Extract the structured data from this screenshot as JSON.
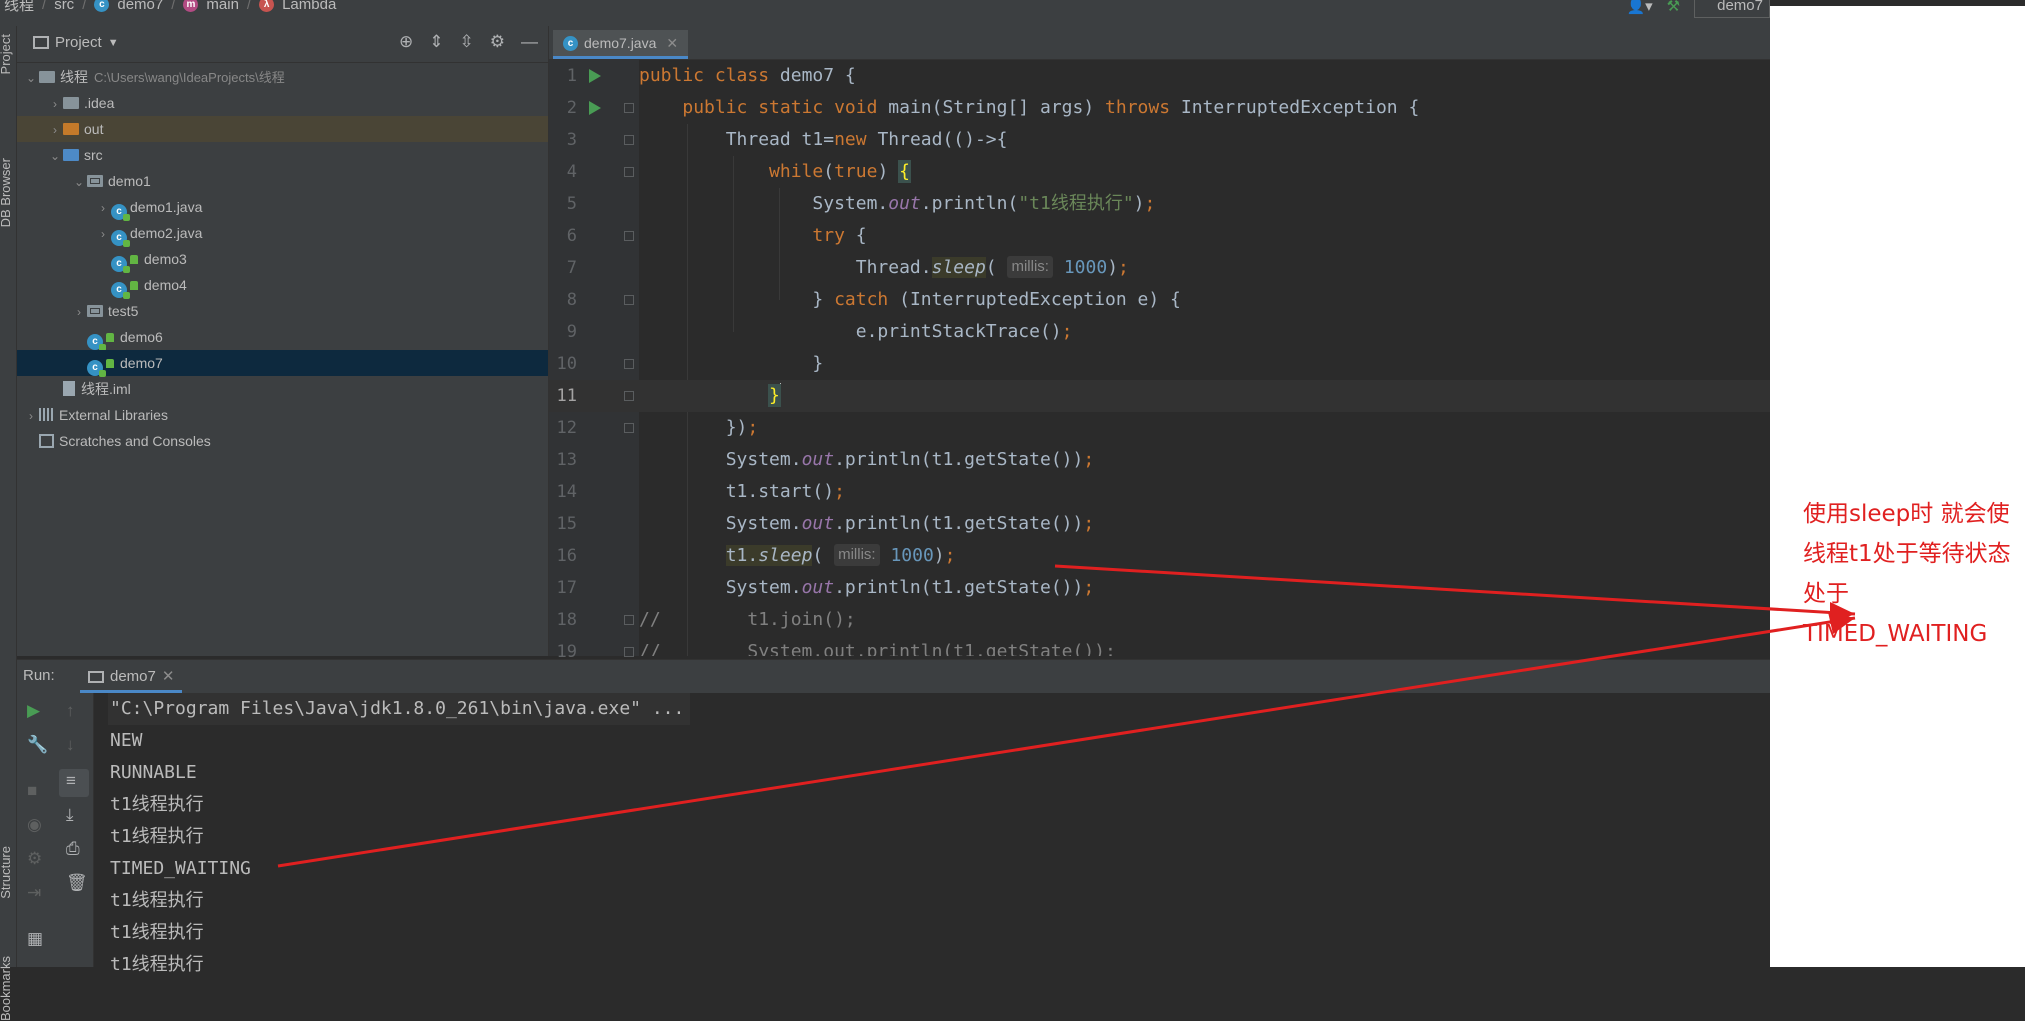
{
  "breadcrumb": {
    "items": [
      "线程",
      "src",
      "demo7",
      "main",
      "Lambda"
    ],
    "run_config": "demo7"
  },
  "left_strip": {
    "tabs": [
      "Project",
      "DB Browser",
      "Structure",
      "Bookmarks"
    ]
  },
  "project_panel": {
    "title": "Project",
    "tree": [
      {
        "label": "线程",
        "path": "C:\\Users\\wang\\IdeaProjects\\线程",
        "kind": "module",
        "depth": 0,
        "expanded": true
      },
      {
        "label": ".idea",
        "kind": "folder",
        "depth": 1,
        "expanded": false
      },
      {
        "label": "out",
        "kind": "folder-out",
        "depth": 1,
        "expanded": false
      },
      {
        "label": "src",
        "kind": "folder-src",
        "depth": 1,
        "expanded": true
      },
      {
        "label": "demo1",
        "kind": "package",
        "depth": 2,
        "expanded": true
      },
      {
        "label": "demo1.java",
        "kind": "class",
        "depth": 3,
        "expanded": false
      },
      {
        "label": "demo2.java",
        "kind": "class",
        "depth": 3,
        "expanded": false
      },
      {
        "label": "demo3",
        "kind": "class-lock",
        "depth": 3
      },
      {
        "label": "demo4",
        "kind": "class-lock",
        "depth": 3
      },
      {
        "label": "test5",
        "kind": "package",
        "depth": 2,
        "expanded": false
      },
      {
        "label": "demo6",
        "kind": "class-lock",
        "depth": 2
      },
      {
        "label": "demo7",
        "kind": "class-lock",
        "depth": 2,
        "selected": true
      },
      {
        "label": "线程.iml",
        "kind": "iml",
        "depth": 1
      },
      {
        "label": "External Libraries",
        "kind": "libs",
        "depth": 0,
        "expanded": false
      },
      {
        "label": "Scratches and Consoles",
        "kind": "scratch",
        "depth": 0
      }
    ]
  },
  "editor": {
    "tab": "demo7.java",
    "current_line": 11,
    "line_numbers": [
      "1",
      "2",
      "3",
      "4",
      "5",
      "6",
      "7",
      "8",
      "9",
      "10",
      "11",
      "12",
      "13",
      "14",
      "15",
      "16",
      "17",
      "18",
      "19"
    ],
    "hints": {
      "millis": "millis:"
    }
  },
  "run_panel": {
    "label": "Run:",
    "tab": "demo7",
    "output": [
      "\"C:\\Program Files\\Java\\jdk1.8.0_261\\bin\\java.exe\" ...",
      "NEW",
      "RUNNABLE",
      "t1线程执行",
      "t1线程执行",
      "TIMED_WAITING",
      "t1线程执行",
      "t1线程执行",
      "t1线程执行"
    ]
  },
  "annotation": {
    "lines": [
      "使用sleep时 就会使",
      "线程t1处于等待状态",
      "处于",
      "TIMED_WAITING"
    ],
    "color": "#e02020"
  },
  "colors": {
    "keyword": "#cc7832",
    "string": "#6a8759",
    "number": "#6897bb",
    "static_field": "#9876aa",
    "default_text": "#a9b7c6",
    "selection": "#0d293e",
    "run_green": "#499c54"
  }
}
